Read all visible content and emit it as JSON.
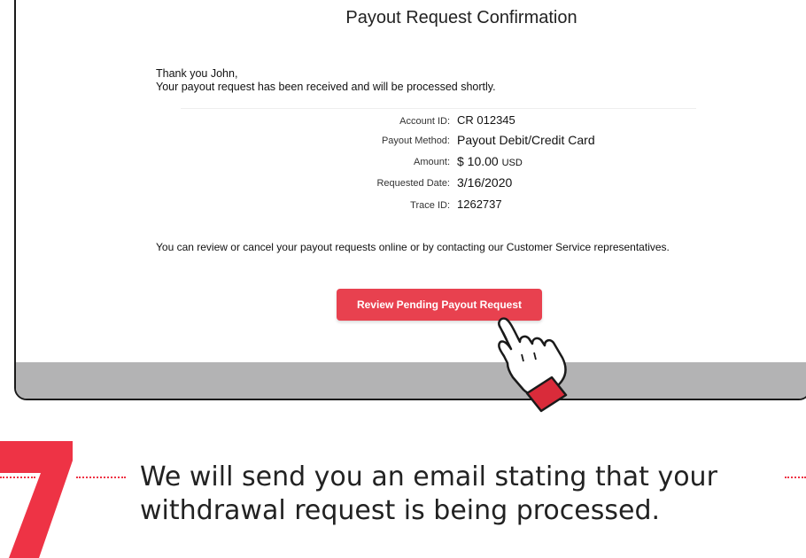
{
  "screen": {
    "title": "Payout Request Confirmation",
    "greeting_line1": "Thank you John,",
    "greeting_line2": "Your payout request has been received and will be processed shortly.",
    "details": [
      {
        "label": "Account ID:",
        "value": "CR 012345",
        "unit": ""
      },
      {
        "label": "Payout Method:",
        "value": "Payout Debit/Credit Card",
        "unit": ""
      },
      {
        "label": "Amount:",
        "value": "$ 10.00",
        "unit": "USD"
      },
      {
        "label": "Requested Date:",
        "value": "3/16/2020",
        "unit": ""
      },
      {
        "label": "Trace ID:",
        "value": "1262737",
        "unit": ""
      }
    ],
    "note": "You can review or cancel your payout requests online or by contacting our Customer Service representatives.",
    "cta_label": "Review Pending Payout Request"
  },
  "step": {
    "number": "7",
    "text": "We will send you an email stating that your withdrawal request is being processed."
  },
  "colors": {
    "accent": "#e8414f",
    "bezel": "#b3b3b4"
  }
}
